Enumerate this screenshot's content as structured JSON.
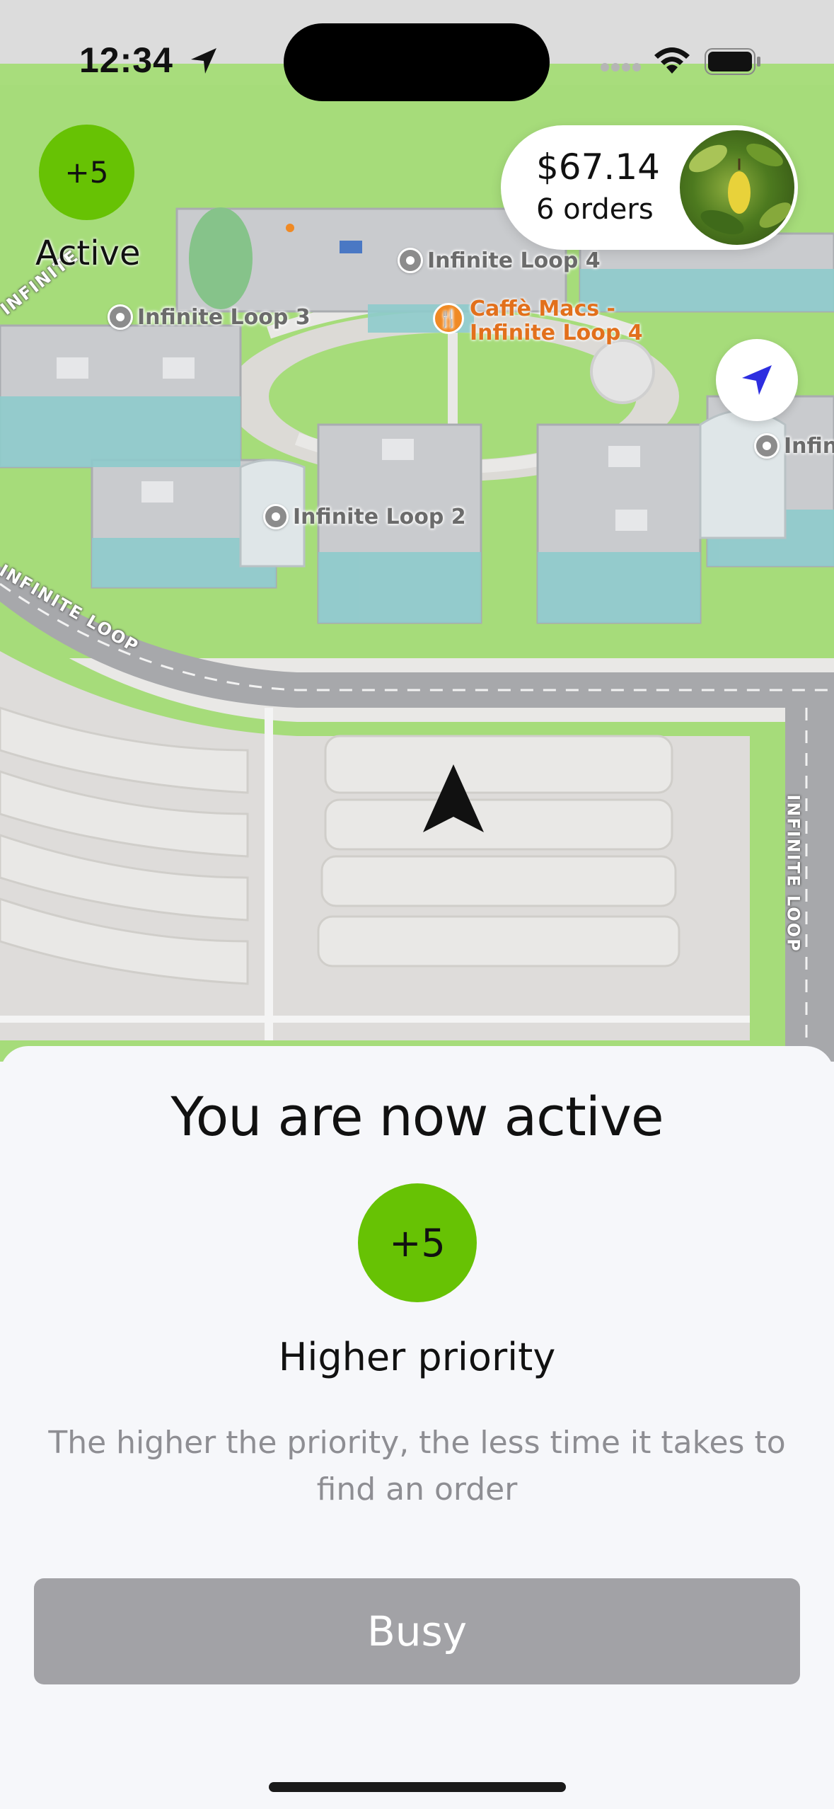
{
  "status_bar": {
    "time": "12:34"
  },
  "map": {
    "labels": {
      "loop4": "Infinite Loop 4",
      "loop3": "Infinite Loop 3",
      "loop2": "Infinite Loop 2",
      "loop_partial": "Infin",
      "cafe_line1": "Caffè Macs -",
      "cafe_line2": "Infinite Loop 4",
      "road_top_left": "INFINITE",
      "road_left": "INFINITE LOOP",
      "road_right": "INFINITE LOOP"
    }
  },
  "priority_badge": {
    "value": "+5",
    "status": "Active",
    "color": "#67c204"
  },
  "earnings": {
    "amount": "$67.14",
    "orders": "6 orders"
  },
  "sheet": {
    "title": "You are now active",
    "badge": "+5",
    "subtitle": "Higher priority",
    "description": "The higher the priority, the less time it takes to find an order",
    "button_label": "Busy"
  },
  "icons": {
    "status": [
      "location-arrow-icon",
      "signal-dots-icon",
      "wifi-icon",
      "battery-icon"
    ],
    "map": [
      "locate-me-icon",
      "navigation-arrow-icon",
      "fork-knife-icon"
    ]
  },
  "colors": {
    "accent_green": "#67c204",
    "button_gray": "#a2a2a6",
    "locate_blue": "#2d2ee0",
    "cafe_orange": "#e2701c"
  }
}
